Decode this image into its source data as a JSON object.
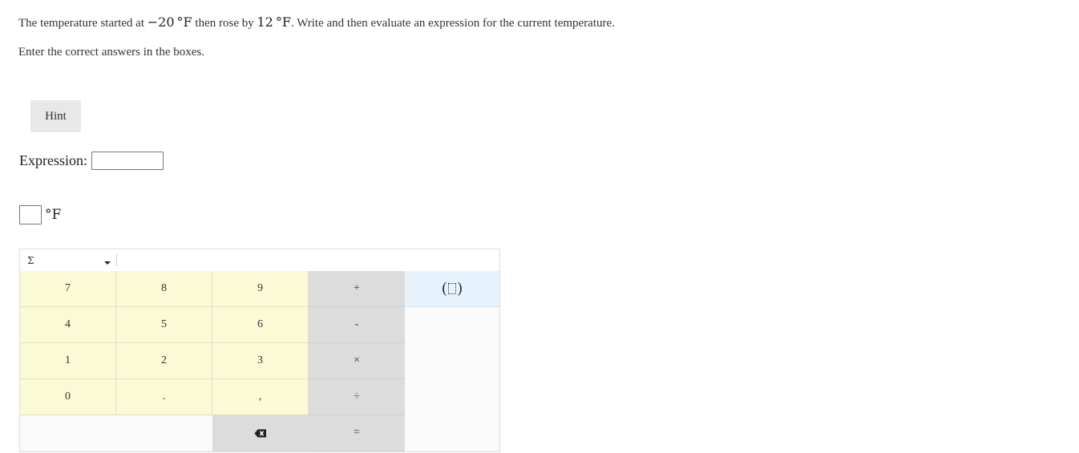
{
  "question": {
    "part1": "The temperature started at ",
    "start_temp": "−20",
    "unit": "°F",
    "part2": " then rose by ",
    "rise": "12",
    "part3": ". Write and then evaluate an expression for the current temperature."
  },
  "instructions": "Enter the correct answers in the boxes.",
  "hint_label": "Hint",
  "expression": {
    "label": "Expression:",
    "value": ""
  },
  "answer": {
    "value": "",
    "unit": "°F"
  },
  "keypad": {
    "palette_symbol": "Σ",
    "keys": {
      "seven": "7",
      "eight": "8",
      "nine": "9",
      "plus": "+",
      "four": "4",
      "five": "5",
      "six": "6",
      "minus": "-",
      "one": "1",
      "two": "2",
      "three": "3",
      "times": "×",
      "zero": "0",
      "decimal": ".",
      "comma": ",",
      "divide": "÷",
      "equals": "="
    },
    "icons": {
      "parentheses": "parentheses-icon",
      "backspace": "backspace-icon",
      "dropdown": "chevron-down-icon"
    },
    "colors": {
      "number_keys": "#fafad7",
      "operator_keys": "#dcdcdc",
      "template_keys": "#e6f2fc"
    }
  }
}
